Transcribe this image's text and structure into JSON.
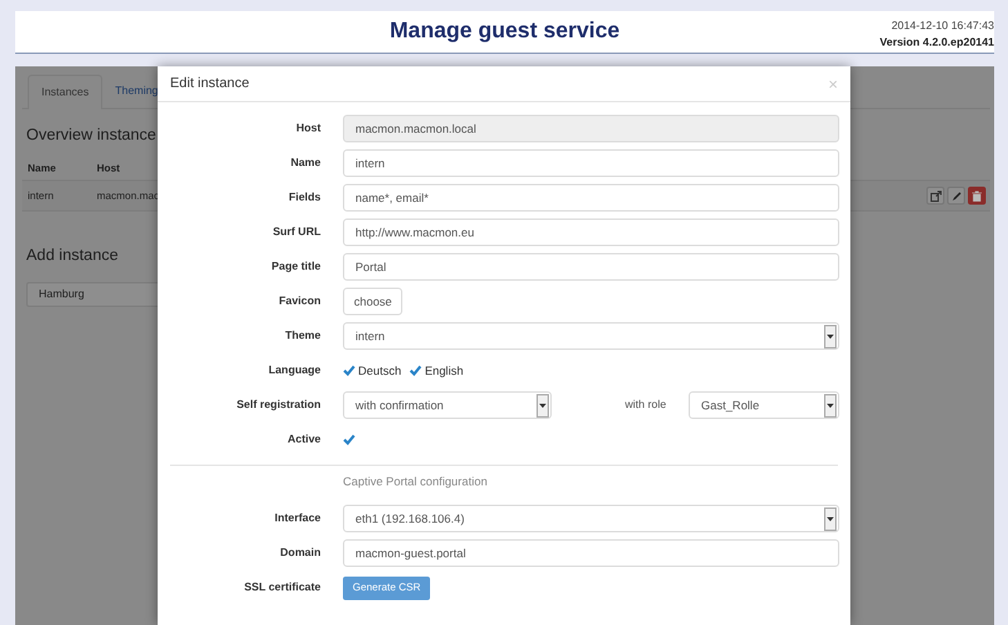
{
  "header": {
    "title": "Manage guest service",
    "timestamp": "2014-12-10 16:47:43",
    "version": "Version 4.2.0.ep20141"
  },
  "background": {
    "tabs": [
      {
        "label": "Instances",
        "selected": true
      },
      {
        "label": "Theming",
        "selected": false
      }
    ],
    "overview_heading": "Overview instance",
    "table": {
      "columns": [
        "Name",
        "Host"
      ],
      "rows": [
        {
          "cells": [
            "intern",
            "macmon.mac"
          ]
        }
      ]
    },
    "add_heading": "Add instance",
    "add_field": {
      "value": "Hamburg"
    }
  },
  "modal": {
    "title": "Edit instance",
    "close": "×",
    "rows": [
      {
        "kind": "text",
        "label": "Host",
        "value": "macmon.macmon.local",
        "disabled": true
      },
      {
        "kind": "text",
        "label": "Name",
        "value": "intern",
        "disabled": false
      },
      {
        "kind": "text",
        "label": "Fields",
        "value": "name*, email*",
        "disabled": false
      },
      {
        "kind": "text",
        "label": "Surf URL",
        "value": "http://www.macmon.eu",
        "disabled": false
      },
      {
        "kind": "text",
        "label": "Page title",
        "value": "Portal",
        "disabled": false
      },
      {
        "kind": "button",
        "label": "Favicon",
        "value": "choose"
      },
      {
        "kind": "select",
        "label": "Theme",
        "value": "intern"
      },
      {
        "kind": "checks",
        "label": "Language",
        "options": [
          {
            "label": "Deutsch",
            "checked": true
          },
          {
            "label": "English",
            "checked": true
          }
        ]
      },
      {
        "kind": "select2",
        "label": "Self registration",
        "value": "with confirmation",
        "second_label": "with role",
        "second_value": "Gast_Rolle"
      },
      {
        "kind": "check",
        "label": "Active",
        "checked": true
      },
      {
        "kind": "divider"
      },
      {
        "kind": "section",
        "text": "Captive Portal configuration"
      },
      {
        "kind": "select",
        "label": "Interface",
        "value": "eth1 (192.168.106.4)"
      },
      {
        "kind": "text",
        "label": "Domain",
        "value": "macmon-guest.portal",
        "disabled": false
      },
      {
        "kind": "primary",
        "label": "SSL certificate",
        "value": "Generate CSR"
      }
    ]
  }
}
